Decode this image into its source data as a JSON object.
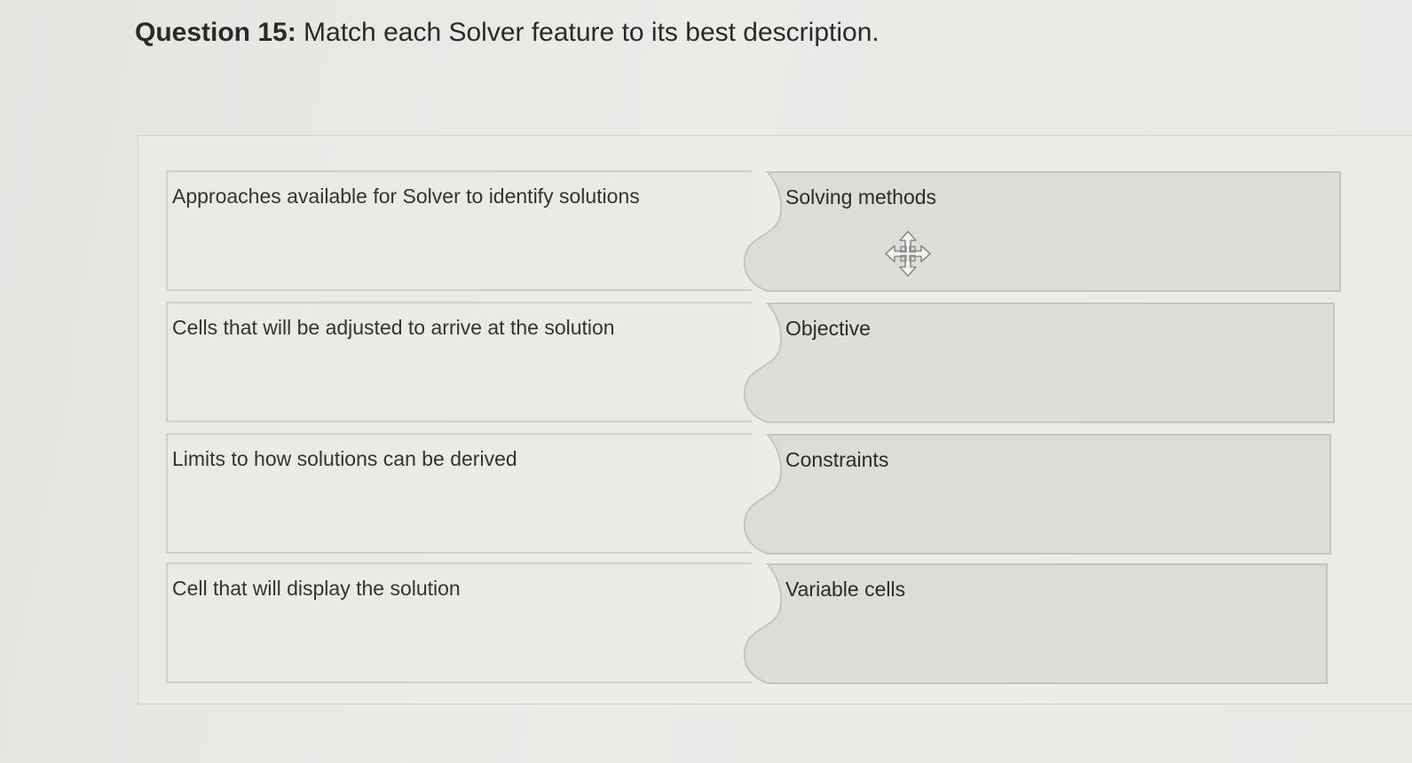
{
  "question": {
    "number": "Question 15:",
    "text": "Match each Solver feature to its best description."
  },
  "pairs": [
    {
      "prompt": "Approaches available for Solver to identify solutions",
      "answer": "Solving methods"
    },
    {
      "prompt": "Cells that will be adjusted to arrive at the solution",
      "answer": "Objective"
    },
    {
      "prompt": "Limits to how solutions can be derived",
      "answer": "Constraints"
    },
    {
      "prompt": "Cell that will display the solution",
      "answer": "Variable cells"
    }
  ],
  "cursor_icon": "move-cursor-icon",
  "colors": {
    "answer_fill": "#dcdcd9",
    "prompt_fill": "#eaeae7",
    "border": "#c4c4c1"
  }
}
